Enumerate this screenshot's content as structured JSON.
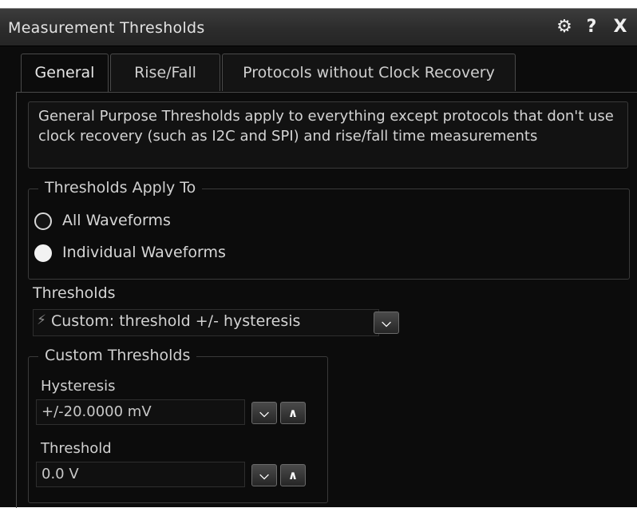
{
  "window": {
    "title": "Measurement Thresholds",
    "gear_icon": "⚙",
    "help_label": "?",
    "close_label": "X"
  },
  "tabs": [
    {
      "label": "General",
      "active": true
    },
    {
      "label": "Rise/Fall",
      "active": false
    },
    {
      "label": "Protocols without Clock Recovery",
      "active": false
    }
  ],
  "general": {
    "description": "General Purpose Thresholds apply to everything except protocols that don't use clock recovery (such as I2C and SPI) and rise/fall time measurements",
    "apply_to": {
      "legend": "Thresholds Apply To",
      "options": [
        {
          "label": "All Waveforms",
          "selected": false
        },
        {
          "label": "Individual Waveforms",
          "selected": true
        }
      ]
    },
    "thresholds": {
      "label": "Thresholds",
      "icon": "⚡",
      "value": "Custom: threshold +/- hysteresis",
      "dropdown_icon": "chevron-down"
    },
    "custom": {
      "legend": "Custom Thresholds",
      "hysteresis_label": "Hysteresis",
      "hysteresis_value": "+/-20.0000 mV",
      "threshold_label": "Threshold",
      "threshold_value": "0.0 V"
    }
  }
}
